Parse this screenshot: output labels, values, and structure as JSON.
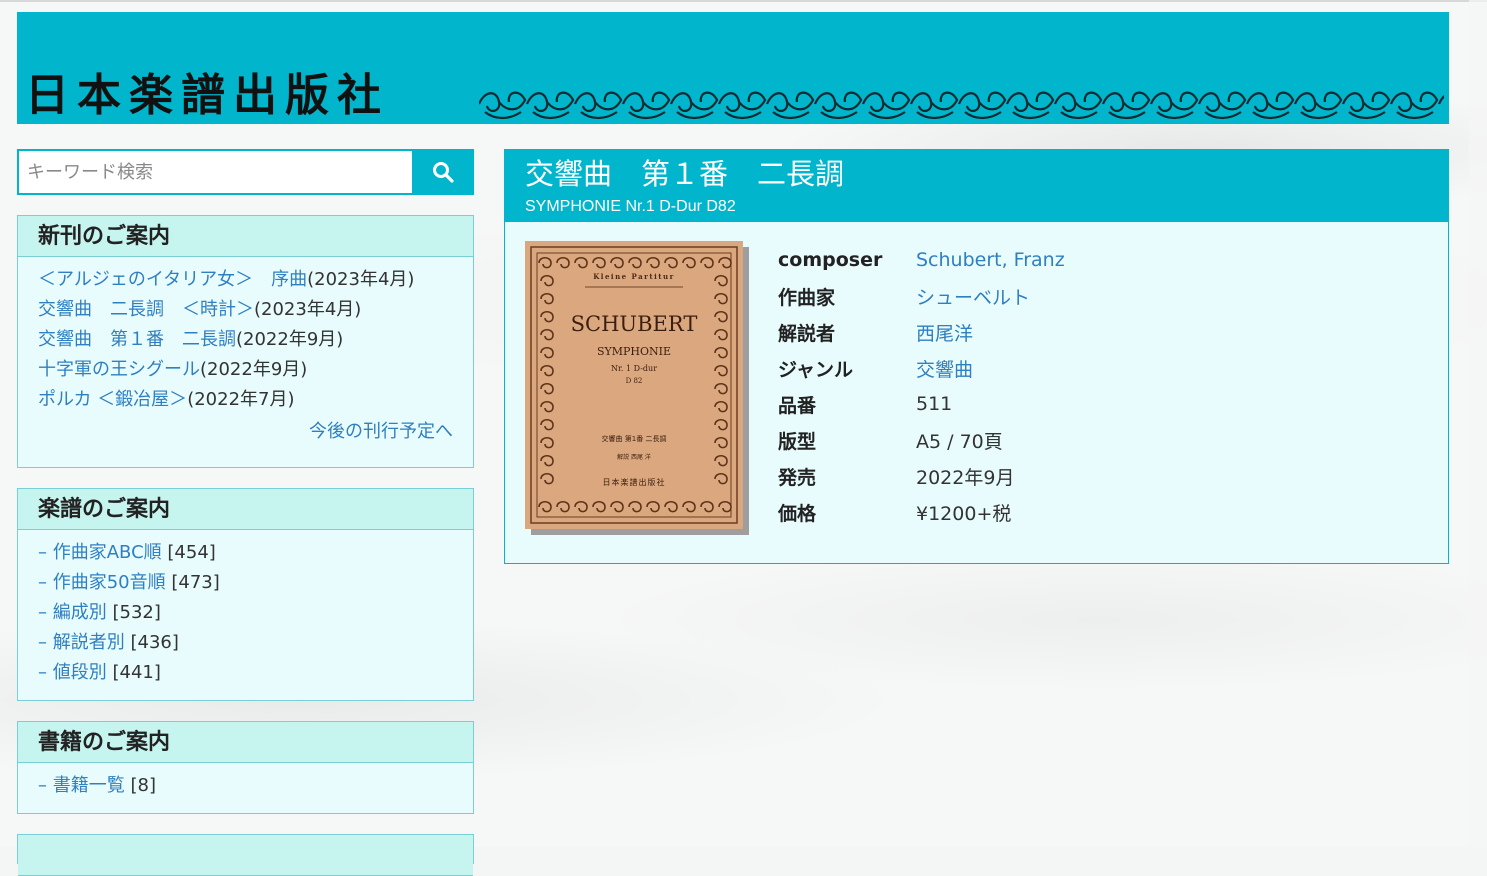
{
  "header": {
    "logo_text": "日本楽譜出版社"
  },
  "search": {
    "placeholder": "キーワード検索",
    "button_icon": "search-icon"
  },
  "sidebar": {
    "new_releases": {
      "title": "新刊のご案内",
      "items": [
        {
          "link": "＜アルジェのイタリア女＞　序曲",
          "meta": "(2023年4月)"
        },
        {
          "link": "交響曲　二長調　＜時計＞",
          "meta": "(2023年4月)"
        },
        {
          "link": "交響曲　第１番　二長調",
          "meta": "(2022年9月)"
        },
        {
          "link": "十字軍の王シグール",
          "meta": "(2022年9月)"
        },
        {
          "link": "ポルカ ＜鍛冶屋＞",
          "meta": "(2022年7月)"
        }
      ],
      "more_link": "今後の刊行予定へ"
    },
    "scores": {
      "title": "楽譜のご案内",
      "items": [
        {
          "prefix": "– ",
          "link": "作曲家ABC順",
          "count": "[454]"
        },
        {
          "prefix": "– ",
          "link": "作曲家50音順",
          "count": "[473]"
        },
        {
          "prefix": "– ",
          "link": "編成別",
          "count": "[532]"
        },
        {
          "prefix": "– ",
          "link": "解説者別",
          "count": "[436]"
        },
        {
          "prefix": "– ",
          "link": "値段別",
          "count": "[441]"
        }
      ]
    },
    "books": {
      "title": "書籍のご案内",
      "items": [
        {
          "prefix": "– ",
          "link": "書籍一覧",
          "count": "[8]"
        }
      ]
    }
  },
  "product": {
    "title": "交響曲　第１番　二長調",
    "subtitle": "SYMPHONIE Nr.1 D-Dur D82",
    "cover": {
      "series": "Kleine Partitur",
      "composer": "SCHUBERT",
      "work": "SYMPHONIE",
      "number": "Nr. 1 D-dur",
      "catalog": "D 82",
      "jp_title": "交響曲 第1番 二長調",
      "jp_commentator": "解説 西尾 洋",
      "publisher": "日本楽譜出版社"
    },
    "specs": [
      {
        "label": "composer",
        "value": "Schubert, Franz",
        "is_link": true
      },
      {
        "label": "作曲家",
        "value": "シューベルト",
        "is_link": true
      },
      {
        "label": "解説者",
        "value": "西尾洋",
        "is_link": true
      },
      {
        "label": "ジャンル",
        "value": "交響曲",
        "is_link": true
      },
      {
        "label": "品番",
        "value": "511",
        "is_link": false
      },
      {
        "label": "版型",
        "value": "A5 / 70頁",
        "is_link": false
      },
      {
        "label": "発売",
        "value": "2022年9月",
        "is_link": false
      },
      {
        "label": "価格",
        "value": "¥1200+税",
        "is_link": false
      }
    ]
  },
  "colors": {
    "accent": "#00b5cc",
    "link": "#2f7fc1",
    "panel_bg": "#e8fcfd",
    "panel_head": "#c6f4ef",
    "cover": "#dba77e"
  }
}
